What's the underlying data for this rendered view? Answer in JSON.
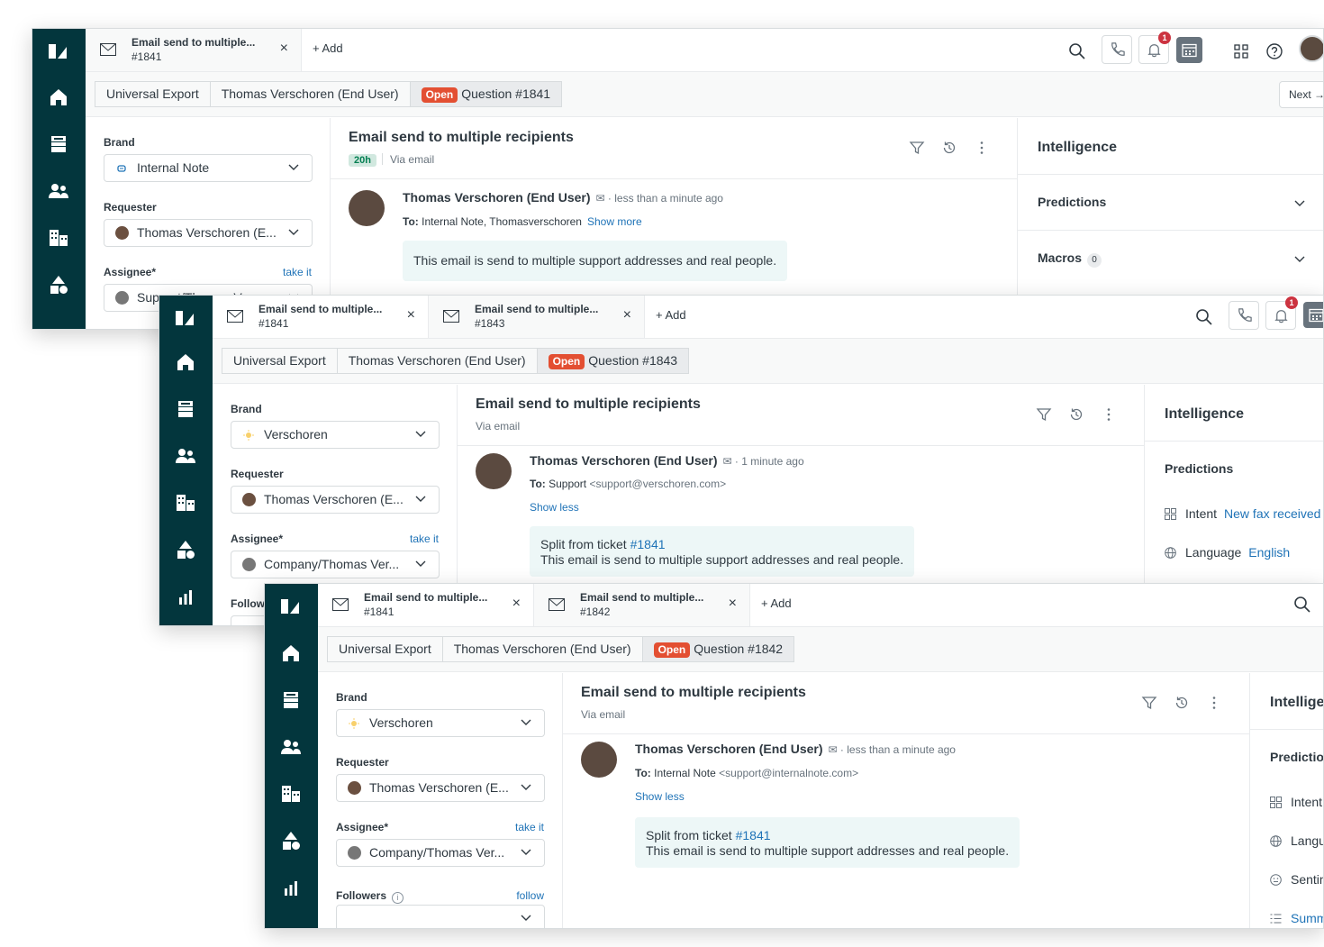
{
  "app": {
    "add_tab_label": "Add",
    "notification_count": "1",
    "next_label": "Next",
    "open_status": "Open"
  },
  "windows": [
    {
      "tabs": [
        {
          "title": "Email send to multiple...",
          "id": "#1841"
        }
      ],
      "breadcrumbs": {
        "org": "Universal Export",
        "user": "Thomas Verschoren (End User)",
        "ticket": "Question #1841"
      },
      "fields": {
        "brand_label": "Brand",
        "brand_value": "Internal Note",
        "requester_label": "Requester",
        "requester_value": "Thomas Verschoren (E...",
        "assignee_label": "Assignee*",
        "assignee_link": "take it",
        "assignee_value": "Support/Thomas Ver..."
      },
      "conversation": {
        "subject": "Email send to multiple recipients",
        "age": "20h",
        "via": "Via email",
        "author": "Thomas Verschoren (End User)",
        "time": "less than a minute ago",
        "to_label": "To:",
        "to_value": "Internal Note, Thomasverschoren",
        "show_more": "Show more",
        "body": "This email is send to multiple support addresses and real people."
      },
      "intelligence": {
        "title": "Intelligence",
        "predictions_label": "Predictions",
        "macros_label": "Macros",
        "macros_count": "0"
      }
    },
    {
      "tabs": [
        {
          "title": "Email send to multiple...",
          "id": "#1841"
        },
        {
          "title": "Email send to multiple...",
          "id": "#1843"
        }
      ],
      "breadcrumbs": {
        "org": "Universal Export",
        "user": "Thomas Verschoren (End User)",
        "ticket": "Question #1843"
      },
      "fields": {
        "brand_label": "Brand",
        "brand_value": "Verschoren",
        "requester_label": "Requester",
        "requester_value": "Thomas Verschoren (E...",
        "assignee_label": "Assignee*",
        "assignee_link": "take it",
        "assignee_value": "Company/Thomas Ver...",
        "followers_label": "Follow"
      },
      "conversation": {
        "subject": "Email send to multiple recipients",
        "via": "Via email",
        "author": "Thomas Verschoren (End User)",
        "time": "1 minute ago",
        "to_label": "To:",
        "to_value": "Support",
        "to_email": "<support@verschoren.com>",
        "show_less": "Show less",
        "split_prefix": "Split from ticket",
        "split_ticket": "#1841",
        "body": "This email is send to multiple support addresses and real people."
      },
      "intelligence": {
        "title": "Intelligence",
        "predictions_label": "Predictions",
        "intent_label": "Intent",
        "intent_value": "New fax received",
        "language_label": "Language",
        "language_value": "English"
      }
    },
    {
      "tabs": [
        {
          "title": "Email send to multiple...",
          "id": "#1841"
        },
        {
          "title": "Email send to multiple...",
          "id": "#1842"
        }
      ],
      "breadcrumbs": {
        "org": "Universal Export",
        "user": "Thomas Verschoren (End User)",
        "ticket": "Question #1842"
      },
      "fields": {
        "brand_label": "Brand",
        "brand_value": "Verschoren",
        "requester_label": "Requester",
        "requester_value": "Thomas Verschoren (E...",
        "assignee_label": "Assignee*",
        "assignee_link": "take it",
        "assignee_value": "Company/Thomas Ver...",
        "followers_label": "Followers",
        "followers_link": "follow"
      },
      "conversation": {
        "subject": "Email send to multiple recipients",
        "via": "Via email",
        "author": "Thomas Verschoren (End User)",
        "time": "less than a minute ago",
        "to_label": "To:",
        "to_value": "Internal Note",
        "to_email": "<support@internalnote.com>",
        "show_less": "Show less",
        "split_prefix": "Split from ticket",
        "split_ticket": "#1841",
        "body": "This email is send to multiple support addresses and real people."
      },
      "intelligence": {
        "title": "Intelligence",
        "predictions_label": "Predictions",
        "intent_label": "Intent",
        "language_label": "Language",
        "sentiment_label": "Sentiment",
        "summary_label": "Summary"
      }
    }
  ],
  "colors": {
    "rail": "#03363d",
    "open_badge": "#e34f32",
    "link": "#1f73b7",
    "bubble": "#edf7f7",
    "notification": "#cc3340"
  },
  "icons": [
    "zendesk-logo-icon",
    "home-icon",
    "views-icon",
    "customers-icon",
    "organizations-icon",
    "objects-icon",
    "reporting-icon",
    "mail-icon",
    "close-icon",
    "search-icon",
    "phone-icon",
    "bell-icon",
    "calendar-icon",
    "apps-grid-icon",
    "help-icon",
    "filter-icon",
    "history-icon",
    "more-icon",
    "chevron-down-icon",
    "intent-icon",
    "language-icon",
    "sentiment-icon",
    "summary-icon",
    "info-icon"
  ]
}
